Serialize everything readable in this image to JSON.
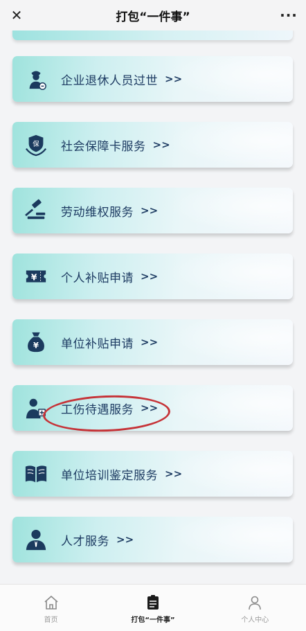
{
  "header": {
    "title": "打包“一件事”",
    "close_icon": "close-icon",
    "more_icon": "more-icon"
  },
  "services": [
    {
      "label": "企业退休人员过世",
      "arrow": ">>",
      "icon": "retiree-icon"
    },
    {
      "label": "社会保障卡服务",
      "arrow": ">>",
      "icon": "social-security-card-icon"
    },
    {
      "label": "劳动维权服务",
      "arrow": ">>",
      "icon": "gavel-icon"
    },
    {
      "label": "个人补贴申请",
      "arrow": ">>",
      "icon": "yuan-ticket-icon"
    },
    {
      "label": "单位补贴申请",
      "arrow": ">>",
      "icon": "money-bag-icon"
    },
    {
      "label": "工伤待遇服务",
      "arrow": ">>",
      "icon": "injured-worker-icon"
    },
    {
      "label": "单位培训鉴定服务",
      "arrow": ">>",
      "icon": "open-book-icon"
    },
    {
      "label": "人才服务",
      "arrow": ">>",
      "icon": "talent-icon"
    }
  ],
  "tabbar": [
    {
      "label": "首页",
      "icon": "home-icon",
      "active": false
    },
    {
      "label": "打包“一件事”",
      "icon": "clipboard-icon",
      "active": true
    },
    {
      "label": "个人中心",
      "icon": "user-icon",
      "active": false
    }
  ],
  "colors": {
    "label": "#1e3c63",
    "icon": "#1b3a5e",
    "highlight_circle": "#c63338",
    "card_gradient_start": "#9fe3dd"
  }
}
